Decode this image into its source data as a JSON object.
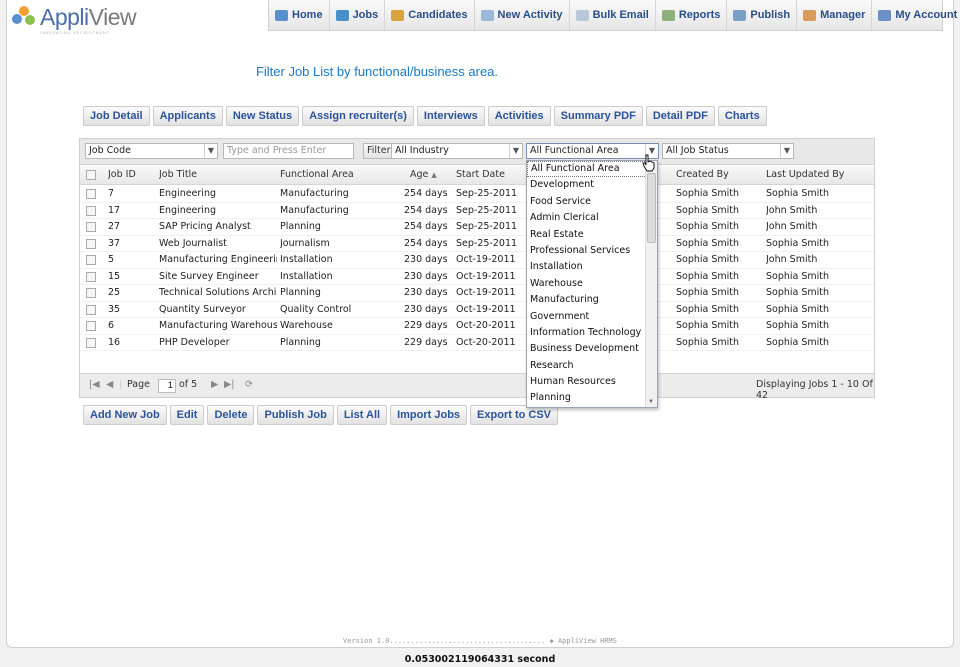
{
  "app": {
    "logo_text_a": "Appli",
    "logo_text_b": "View",
    "tagline": "INNOVATING RECRUITMENT"
  },
  "topnav": [
    {
      "label": "Home",
      "icon": "home-icon",
      "color": "#5a8fd0"
    },
    {
      "label": "Jobs",
      "icon": "jobs-icon",
      "color": "#4a90c8"
    },
    {
      "label": "Candidates",
      "icon": "candidates-icon",
      "color": "#d9a23a"
    },
    {
      "label": "New Activity",
      "icon": "activity-icon",
      "color": "#9cb8d8"
    },
    {
      "label": "Bulk Email",
      "icon": "email-icon",
      "color": "#b8c8d8"
    },
    {
      "label": "Reports",
      "icon": "reports-icon",
      "color": "#8fb07a"
    },
    {
      "label": "Publish",
      "icon": "publish-icon",
      "color": "#7aa0c8"
    },
    {
      "label": "Manager",
      "icon": "manager-icon",
      "color": "#d99a5a"
    },
    {
      "label": "My Account",
      "icon": "account-icon",
      "color": "#6a90c8"
    }
  ],
  "page_heading": "Filter Job List by functional/business area.",
  "tabs": [
    "Job Detail",
    "Applicants",
    "New Status",
    "Assign recruiter(s)",
    "Interviews",
    "Activities",
    "Summary PDF",
    "Detail PDF",
    "Charts"
  ],
  "filters": {
    "field_select": "Job Code",
    "search_placeholder": "Type and Press Enter",
    "filter_label": "Filter",
    "industry_select": "All Industry",
    "area_select": "All Functional Area",
    "status_select": "All Job Status"
  },
  "columns": {
    "job_id": "Job ID",
    "job_title": "Job Title",
    "functional_area": "Functional Area",
    "age": "Age",
    "start_date": "Start Date",
    "created_by": "Created By",
    "last_updated_by": "Last Updated By"
  },
  "rows": [
    {
      "id": "7",
      "title": "Engineering",
      "area": "Manufacturing",
      "age": "254 days",
      "start": "Sep-25-2011",
      "created": "Sophia Smith",
      "updated": "Sophia Smith"
    },
    {
      "id": "17",
      "title": "Engineering",
      "area": "Manufacturing",
      "age": "254 days",
      "start": "Sep-25-2011",
      "created": "Sophia Smith",
      "updated": "John Smith"
    },
    {
      "id": "27",
      "title": "SAP Pricing Analyst",
      "area": "Planning",
      "age": "254 days",
      "start": "Sep-25-2011",
      "created": "Sophia Smith",
      "updated": "John Smith"
    },
    {
      "id": "37",
      "title": "Web Journalist",
      "area": "Journalism",
      "age": "254 days",
      "start": "Sep-25-2011",
      "created": "Sophia Smith",
      "updated": "Sophia Smith"
    },
    {
      "id": "5",
      "title": "Manufacturing Engineering",
      "area": "Installation",
      "age": "230 days",
      "start": "Oct-19-2011",
      "created": "Sophia Smith",
      "updated": "John Smith"
    },
    {
      "id": "15",
      "title": "Site Survey Engineer",
      "area": "Installation",
      "age": "230 days",
      "start": "Oct-19-2011",
      "created": "Sophia Smith",
      "updated": "Sophia Smith"
    },
    {
      "id": "25",
      "title": "Technical Solutions Archi...",
      "area": "Planning",
      "age": "230 days",
      "start": "Oct-19-2011",
      "created": "Sophia Smith",
      "updated": "Sophia Smith"
    },
    {
      "id": "35",
      "title": "Quantity Surveyor",
      "area": "Quality Control",
      "age": "230 days",
      "start": "Oct-19-2011",
      "created": "Sophia Smith",
      "updated": "Sophia Smith"
    },
    {
      "id": "6",
      "title": "Manufacturing Warehouse",
      "area": "Warehouse",
      "age": "229 days",
      "start": "Oct-20-2011",
      "created": "Sophia Smith",
      "updated": "Sophia Smith"
    },
    {
      "id": "16",
      "title": "PHP Developer",
      "area": "Planning",
      "age": "229 days",
      "start": "Oct-20-2011",
      "created": "Sophia Smith",
      "updated": "Sophia Smith"
    }
  ],
  "pager": {
    "page_label": "Page",
    "page_value": "1",
    "of_label": "of 5",
    "display_text": "Displaying Jobs 1 - 10 Of 42"
  },
  "dropdown_options": [
    "All Functional Area",
    "Development",
    "Food Service",
    "Admin Clerical",
    "Real Estate",
    "Professional Services",
    "Installation",
    "Warehouse",
    "Manufacturing",
    "Government",
    "Information Technology",
    "Business Development",
    "Research",
    "Human Resources",
    "Planning"
  ],
  "actions": [
    "Add New Job",
    "Edit",
    "Delete",
    "Publish Job",
    "List All",
    "Import Jobs",
    "Export to CSV"
  ],
  "footer_text": "Version 1.0..................................... ◆ AppliView HRMS",
  "timer_text": "0.053002119064331 second"
}
